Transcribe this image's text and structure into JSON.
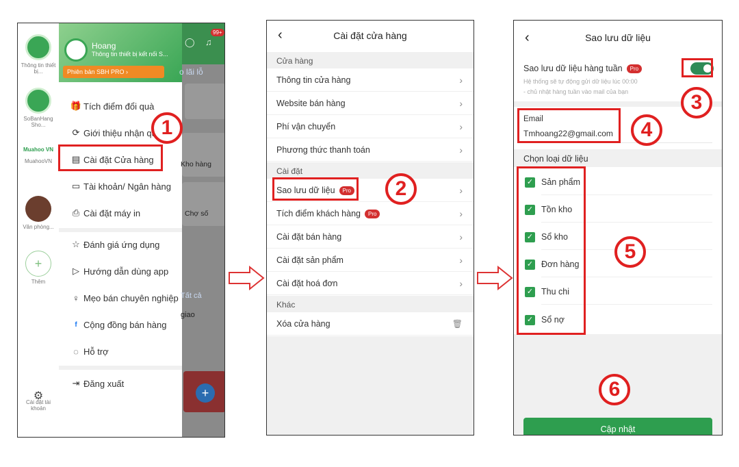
{
  "panel1": {
    "rail": [
      {
        "label": "Thông tin thiết bị..."
      },
      {
        "label": "SoBanHang Sho..."
      },
      {
        "label": "MuahooVN",
        "logo": "Muahoo VN"
      },
      {
        "label": "Văn phòng..."
      },
      {
        "label": "Thêm"
      }
    ],
    "rail_settings": "Cài đặt tài khoản",
    "user": {
      "name": "Hoang",
      "subtitle": "Thông tin thiết bị kết nối S...",
      "badge": "Phiên bản SBH PRO"
    },
    "menu": [
      {
        "label": "Tích điểm đổi quà",
        "icon": "gift-icon"
      },
      {
        "label": "Giới thiệu nhận quà",
        "icon": "share-icon"
      },
      {
        "label": "Cài đặt Cửa hàng",
        "icon": "store-icon"
      },
      {
        "label": "Tài khoản/ Ngân hàng",
        "icon": "card-icon"
      },
      {
        "label": "Cài đặt máy in",
        "icon": "printer-icon"
      },
      {
        "label": "Đánh giá ứng dụng",
        "icon": "star-icon"
      },
      {
        "label": "Hướng dẫn dùng app",
        "icon": "play-icon"
      },
      {
        "label": "Mẹo bán chuyên nghiệp",
        "icon": "bulb-icon"
      },
      {
        "label": "Cộng đồng bán hàng",
        "icon": "facebook-icon"
      },
      {
        "label": "Hỗ trợ",
        "icon": "chat-icon"
      },
      {
        "label": "Đăng xuất",
        "icon": "logout-icon"
      }
    ],
    "behind": {
      "lai_lo": "o lãi lỗ",
      "kho_hang": "Kho hàng",
      "cho_so": "Chợ số",
      "tat_ca": "Tất cả",
      "giao": "giao",
      "badge": "99+"
    }
  },
  "panel2": {
    "title": "Cài đặt cửa hàng",
    "sections": [
      {
        "header": "Cửa hàng",
        "rows": [
          "Thông tin cửa hàng",
          "Website bán hàng",
          "Phí vận chuyển",
          "Phương thức thanh toán"
        ]
      },
      {
        "header": "Cài đặt",
        "rows": [
          "Sao lưu dữ liệu",
          "Tích điểm khách hàng",
          "Cài đặt bán hàng",
          "Cài đặt sản phẩm",
          "Cài đặt hoá đơn"
        ]
      },
      {
        "header": "Khác",
        "rows": [
          "Xóa cửa hàng"
        ]
      }
    ],
    "pro": "Pro"
  },
  "panel3": {
    "title": "Sao lưu dữ liệu",
    "weekly_label": "Sao lưu dữ liệu hàng tuần",
    "pro": "Pro",
    "toggle_on": true,
    "desc1": "Hệ thống sẽ tự động gửi dữ liệu lúc 00:00",
    "desc2": "- chủ nhật hàng tuần vào mail của bạn",
    "email_label": "Email",
    "email_value": "Tmhoang22@gmail.com",
    "choose_label": "Chọn loại dữ liệu",
    "types": [
      "Sản phẩm",
      "Tồn kho",
      "Sổ kho",
      "Đơn hàng",
      "Thu chi",
      "Sổ nợ"
    ],
    "button": "Cập nhật"
  },
  "steps": [
    "1",
    "2",
    "3",
    "4",
    "5",
    "6"
  ],
  "colors": {
    "accent": "#2e9e4f",
    "annotation": "#e02020",
    "pro": "#d32f2f"
  }
}
